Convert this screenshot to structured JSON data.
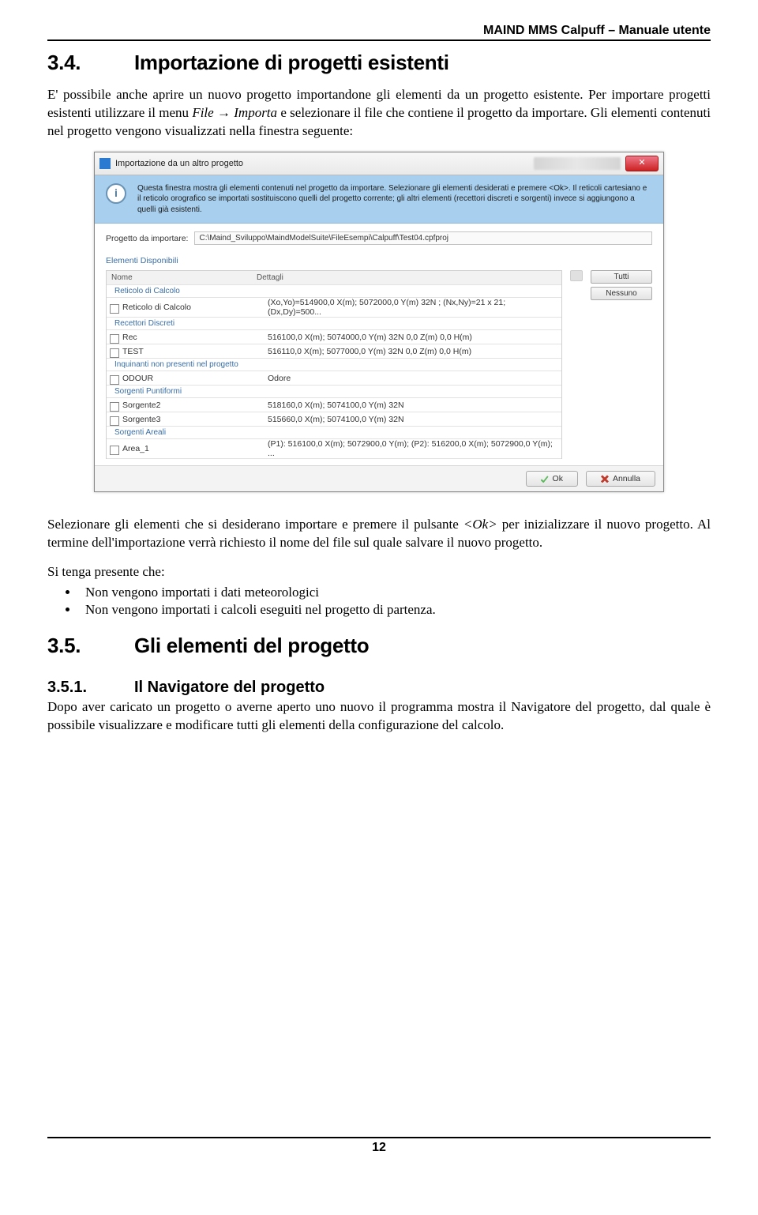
{
  "header": "MAIND MMS Calpuff – Manuale utente",
  "section34": {
    "num": "3.4.",
    "title": "Importazione di progetti esistenti",
    "para1a": "E' possibile anche aprire un nuovo progetto importandone gli elementi da un progetto esistente. Per importare progetti esistenti utilizzare il menu ",
    "file_italic": "File → Importa",
    "para1b": " e selezionare il file che contiene il progetto da importare. Gli elementi contenuti nel progetto vengono visualizzati nella finestra seguente:"
  },
  "dialog": {
    "title": "Importazione da un altro progetto",
    "info_text": "Questa finestra mostra gli elementi contenuti nel progetto da importare. Selezionare gli elementi desiderati e premere <Ok>. Il reticoli cartesiano e il reticolo orografico se importati sostituiscono quelli del progetto corrente; gli altri elementi (recettori discreti e sorgenti) invece si aggiungono a quelli già esistenti.",
    "path_label": "Progetto da importare:",
    "path_value": "C:\\Maind_Sviluppo\\MaindModelSuite\\FileEsempi\\Calpuff\\Test04.cpfproj",
    "available_label": "Elementi Disponibili",
    "col_name": "Nome",
    "col_details": "Dettagli",
    "groups": [
      {
        "title": "Reticolo di Calcolo",
        "rows": [
          {
            "name": "Reticolo di Calcolo",
            "details": "(Xo,Yo)=514900,0 X(m); 5072000,0 Y(m) 32N ; (Nx,Ny)=21 x 21; (Dx,Dy)=500..."
          }
        ]
      },
      {
        "title": "Recettori Discreti",
        "rows": [
          {
            "name": "Rec",
            "details": "516100,0 X(m); 5074000,0 Y(m) 32N  0,0 Z(m) 0,0 H(m)"
          },
          {
            "name": "TEST",
            "details": "516110,0 X(m); 5077000,0 Y(m) 32N  0,0 Z(m) 0,0 H(m)"
          }
        ]
      },
      {
        "title": "Inquinanti non presenti nel progetto",
        "rows": [
          {
            "name": "ODOUR",
            "details": "Odore"
          }
        ]
      },
      {
        "title": "Sorgenti Puntiformi",
        "rows": [
          {
            "name": "Sorgente2",
            "details": "518160,0 X(m); 5074100,0 Y(m) 32N"
          },
          {
            "name": "Sorgente3",
            "details": "515660,0 X(m); 5074100,0 Y(m) 32N"
          }
        ]
      },
      {
        "title": "Sorgenti Areali",
        "rows": [
          {
            "name": "Area_1",
            "details": "(P1): 516100,0 X(m); 5072900,0 Y(m); (P2): 516200,0 X(m); 5072900,0 Y(m); ..."
          }
        ]
      }
    ],
    "btn_all": "Tutti",
    "btn_none": "Nessuno",
    "btn_ok": "Ok",
    "btn_cancel": "Annulla"
  },
  "after_dialog": {
    "para_a": "Selezionare gli elementi che si desiderano importare e premere il pulsante ",
    "ok_italic": "<Ok>",
    "para_b": " per inizializzare il nuovo progetto. Al termine dell'importazione verrà richiesto il nome del file sul quale salvare il nuovo progetto.",
    "note_lead": "Si tenga presente che:",
    "bullet1": "Non vengono importati  i dati meteorologici",
    "bullet2": "Non vengono importati i calcoli eseguiti nel progetto di partenza."
  },
  "section35": {
    "num": "3.5.",
    "title": "Gli elementi del progetto"
  },
  "section351": {
    "num": "3.5.1.",
    "title": "Il Navigatore del progetto",
    "para": "Dopo aver caricato un progetto o averne aperto uno nuovo il programma mostra il Navigatore del progetto, dal quale è possibile visualizzare e modificare tutti gli elementi della configurazione del calcolo."
  },
  "page_number": "12"
}
